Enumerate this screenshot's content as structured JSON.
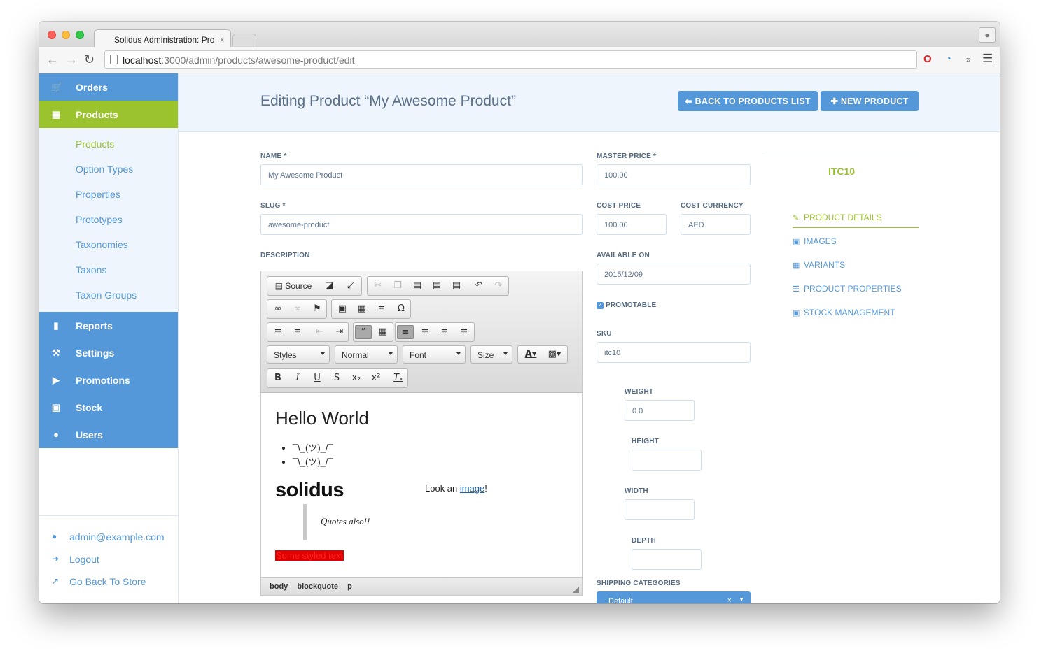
{
  "browser": {
    "tab_title": "Solidus Administration: Pro",
    "tab_close": "×",
    "url_host": "localhost",
    "url_path": ":3000/admin/products/awesome-product/edit"
  },
  "sidebar": {
    "top_items": [
      {
        "label": "Orders",
        "icon": "cart-icon"
      },
      {
        "label": "Products",
        "icon": "grid-icon"
      }
    ],
    "sub_items": [
      "Products",
      "Option Types",
      "Properties",
      "Prototypes",
      "Taxonomies",
      "Taxons",
      "Taxon Groups"
    ],
    "bottom_items": [
      {
        "label": "Reports",
        "icon": "file-icon"
      },
      {
        "label": "Settings",
        "icon": "wrench-icon"
      },
      {
        "label": "Promotions",
        "icon": "bullhorn-icon"
      },
      {
        "label": "Stock",
        "icon": "cubes-icon"
      },
      {
        "label": "Users",
        "icon": "user-icon"
      }
    ],
    "footer": [
      "admin@example.com",
      "Logout",
      "Go Back To Store"
    ]
  },
  "header": {
    "title": "Editing Product “My Awesome Product”",
    "back_button": "BACK TO PRODUCTS LIST",
    "new_button": "NEW PRODUCT"
  },
  "form": {
    "name_label": "NAME *",
    "name_value": "My Awesome Product",
    "slug_label": "SLUG *",
    "slug_value": "awesome-product",
    "description_label": "DESCRIPTION",
    "master_price_label": "MASTER PRICE *",
    "master_price_value": "100.00",
    "cost_price_label": "COST PRICE",
    "cost_price_value": "100.00",
    "cost_currency_label": "COST CURRENCY",
    "cost_currency_value": "AED",
    "available_on_label": "AVAILABLE ON",
    "available_on_value": "2015/12/09",
    "promotable_label": "PROMOTABLE",
    "sku_label": "SKU",
    "sku_value": "itc10",
    "weight_label": "WEIGHT",
    "weight_value": "0.0",
    "height_label": "HEIGHT",
    "width_label": "WIDTH",
    "depth_label": "DEPTH",
    "shipping_label": "SHIPPING CATEGORIES",
    "shipping_value": "Default"
  },
  "editor": {
    "source_label": "Source",
    "styles": "Styles",
    "format": "Normal",
    "font": "Font",
    "size": "Size",
    "heading": "Hello World",
    "list_items": [
      "¯\\_(ツ)_/¯",
      "¯\\_(ツ)_/¯"
    ],
    "logo_text": "solidus",
    "look_prefix": "Look an ",
    "look_link": "image",
    "look_suffix": "!",
    "quote": "Quotes also!!",
    "styled_text": "Some styled text",
    "path": [
      "body",
      "blockquote",
      "p"
    ]
  },
  "product_panel": {
    "sku_title": "ITC10",
    "tabs": [
      {
        "label": "PRODUCT DETAILS",
        "icon": "edit-icon"
      },
      {
        "label": "IMAGES",
        "icon": "image-icon"
      },
      {
        "label": "VARIANTS",
        "icon": "grid-icon"
      },
      {
        "label": "PRODUCT PROPERTIES",
        "icon": "list-icon"
      },
      {
        "label": "STOCK MANAGEMENT",
        "icon": "cubes-icon"
      }
    ]
  },
  "colors": {
    "primary": "#5498da",
    "accent_green": "#9ac32e",
    "header_bg": "#eef5fc",
    "title_text": "#5a6f8a"
  }
}
